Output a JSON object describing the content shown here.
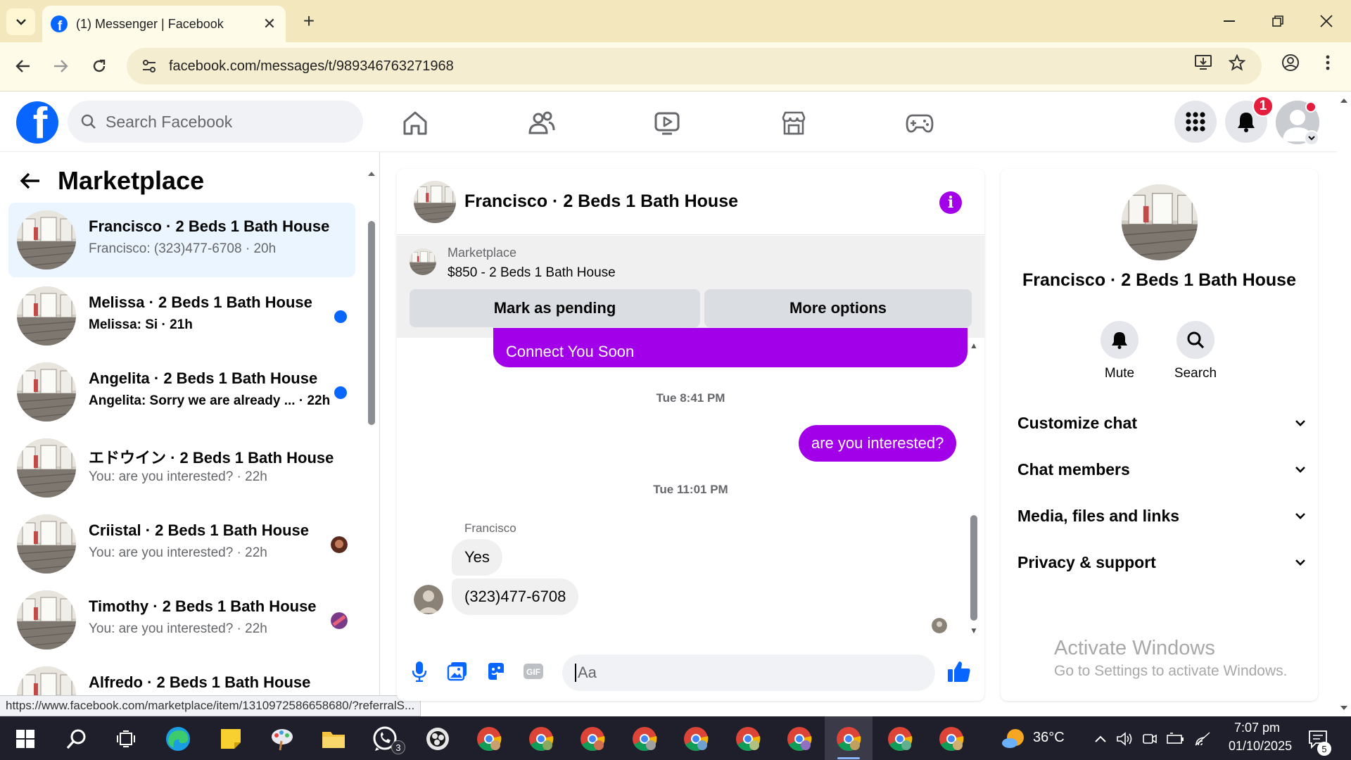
{
  "browser": {
    "tab_title": "(1) Messenger | Facebook",
    "url": "facebook.com/messages/t/989346763271968",
    "status_url": "https://www.facebook.com/marketplace/item/1310972586658680/?referralS..."
  },
  "fb": {
    "search_placeholder": "Search Facebook",
    "notification_count": "1"
  },
  "left": {
    "title": "Marketplace",
    "conversations": [
      {
        "name": "Francisco · 2 Beds 1 Bath House",
        "preview": "Francisco: (323)477-6708 · 20h",
        "unread": false,
        "active": true
      },
      {
        "name": "Melissa · 2 Beds 1 Bath House",
        "preview": "Melissa: Si · 21h",
        "unread": true,
        "active": false
      },
      {
        "name": "Angelita · 2 Beds 1 Bath House",
        "preview": "Angelita: Sorry we are already ... · 22h",
        "unread": true,
        "active": false
      },
      {
        "name": "エドウイン · 2 Beds 1 Bath House",
        "preview": "You: are you interested? · 22h",
        "unread": false,
        "active": false
      },
      {
        "name": "Criistal · 2 Beds 1 Bath House",
        "preview": "You: are you interested? · 22h",
        "unread": false,
        "active": false
      },
      {
        "name": "Timothy · 2 Beds 1 Bath House",
        "preview": "You: are you interested? · 22h",
        "unread": false,
        "active": false
      },
      {
        "name": "Alfredo · 2 Beds 1 Bath House",
        "preview": "",
        "unread": false,
        "active": false
      }
    ]
  },
  "chat": {
    "title": "Francisco · 2 Beds 1 Bath House",
    "marketplace_label": "Marketplace",
    "listing": "$850 - 2 Beds 1 Bath House",
    "mark_pending": "Mark as pending",
    "more_options": "More options",
    "messages": {
      "out_partial": "Connect You Soon",
      "ts1": "Tue 8:41 PM",
      "out1": "are you interested?",
      "ts2": "Tue 11:01 PM",
      "sender": "Francisco",
      "in1": "Yes",
      "in2": "(323)477-6708"
    },
    "composer_placeholder": "Aa",
    "gif_label": "GIF"
  },
  "info": {
    "name": "Francisco · 2 Beds 1 Bath House",
    "mute": "Mute",
    "search": "Search",
    "rows": [
      "Customize chat",
      "Chat members",
      "Media, files and links",
      "Privacy & support"
    ],
    "activate_title": "Activate Windows",
    "activate_sub": "Go to Settings to activate Windows."
  },
  "taskbar": {
    "weather": "36°C",
    "time": "7:07 pm",
    "date": "01/10/2025",
    "whatsapp_badge": "3",
    "notif_count": "5"
  },
  "colors": {
    "accent_purple": "#a100e8",
    "fb_blue": "#0866ff",
    "unread_blue": "#0866ff"
  }
}
